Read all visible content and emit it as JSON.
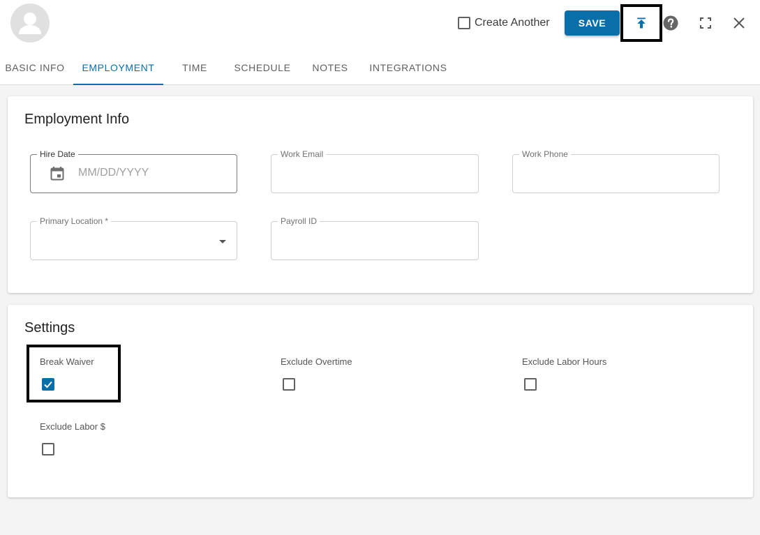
{
  "header": {
    "create_another_label": "Create Another",
    "create_another_checked": false,
    "save_label": "SAVE",
    "icons": [
      "avatar-icon",
      "upload-icon",
      "help-icon",
      "fullscreen-icon",
      "close-icon"
    ]
  },
  "tabs": [
    {
      "label": "BASIC INFO",
      "active": false
    },
    {
      "label": "EMPLOYMENT",
      "active": true
    },
    {
      "label": "TIME",
      "active": false
    },
    {
      "label": "SCHEDULE",
      "active": false
    },
    {
      "label": "NOTES",
      "active": false
    },
    {
      "label": "INTEGRATIONS",
      "active": false
    }
  ],
  "employment_info": {
    "title": "Employment Info",
    "hire_date": {
      "label": "Hire Date",
      "placeholder": "MM/DD/YYYY",
      "value": ""
    },
    "work_email": {
      "label": "Work Email",
      "value": ""
    },
    "work_phone": {
      "label": "Work Phone",
      "value": ""
    },
    "primary_location": {
      "label": "Primary Location *",
      "value": ""
    },
    "payroll_id": {
      "label": "Payroll ID",
      "value": ""
    }
  },
  "settings": {
    "title": "Settings",
    "break_waiver": {
      "label": "Break Waiver",
      "checked": true
    },
    "exclude_overtime": {
      "label": "Exclude Overtime",
      "checked": false
    },
    "exclude_labor_hours": {
      "label": "Exclude Labor Hours",
      "checked": false
    },
    "exclude_labor_dollars": {
      "label": "Exclude Labor $",
      "checked": false
    }
  },
  "colors": {
    "accent": "#0a6ea8",
    "background": "#f4f4f4",
    "highlight": "#000000"
  }
}
